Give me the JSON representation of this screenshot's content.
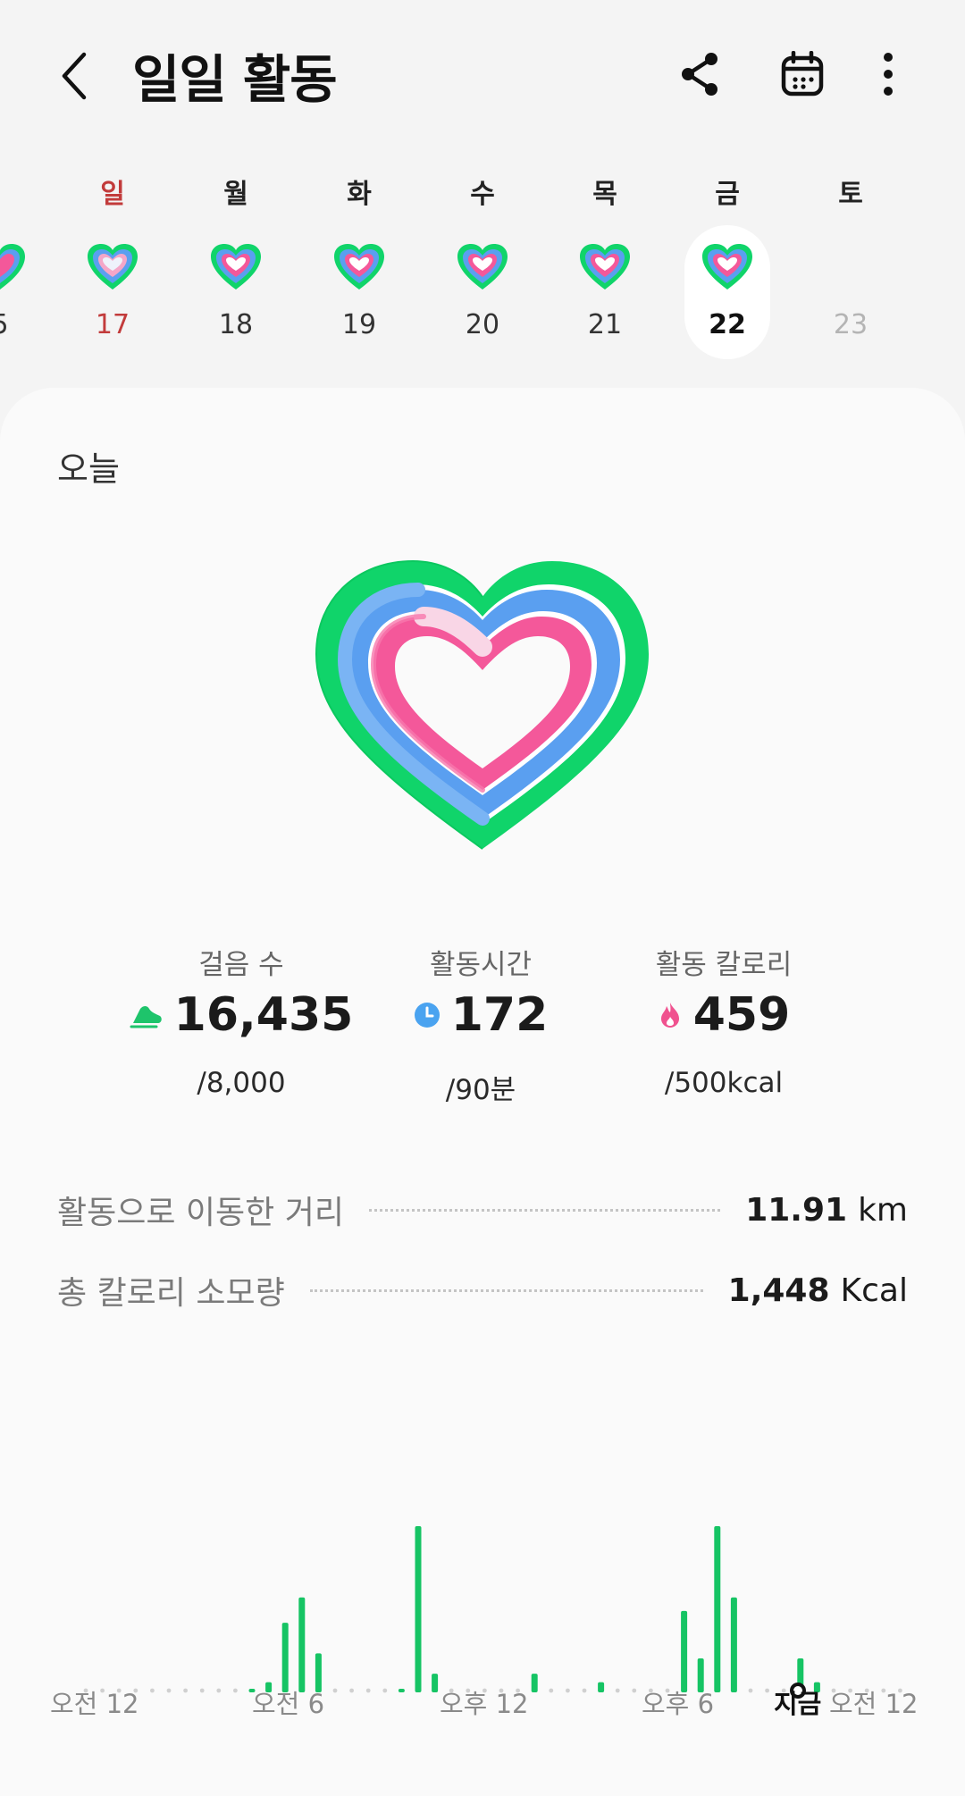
{
  "header": {
    "title": "일일 활동",
    "back_icon": "chevron-left-icon",
    "share_icon": "share-icon",
    "calendar_icon": "calendar-icon",
    "more_icon": "more-vertical-icon"
  },
  "week": {
    "days": [
      {
        "name": "일",
        "date": "17",
        "is_sunday": true
      },
      {
        "name": "월",
        "date": "18"
      },
      {
        "name": "화",
        "date": "19"
      },
      {
        "name": "수",
        "date": "20"
      },
      {
        "name": "목",
        "date": "21"
      },
      {
        "name": "금",
        "date": "22",
        "selected": true
      },
      {
        "name": "토",
        "date": "23",
        "future": true
      }
    ],
    "partial_prev_date": "5"
  },
  "today": {
    "label": "오늘"
  },
  "stats": [
    {
      "label": "걸음 수",
      "value": "16,435",
      "goal": "/8,000",
      "icon": "shoe-icon",
      "color": "#1ec46b"
    },
    {
      "label": "활동시간",
      "value": "172",
      "goal": "/90분",
      "icon": "clock-icon",
      "color": "#4aa3f0"
    },
    {
      "label": "활동 칼로리",
      "value": "459",
      "goal": "/500kcal",
      "icon": "flame-icon",
      "color": "#f0528f"
    }
  ],
  "metrics": [
    {
      "label": "활동으로 이동한 거리",
      "value": "11.91",
      "unit": "km"
    },
    {
      "label": "총 칼로리 소모량",
      "value": "1,448",
      "unit": "Kcal"
    }
  ],
  "colors": {
    "ring_green": "#10d46a",
    "ring_blue": "#5a9ff0",
    "ring_pink": "#f4589a",
    "sunday_red": "#c23b3b",
    "bar_green": "#16c464"
  },
  "chart_data": {
    "type": "bar",
    "x_labels": [
      "오전 12",
      "오전 6",
      "오후 12",
      "오후 6",
      "지금",
      "오전 12"
    ],
    "values": [
      0,
      0,
      0,
      0,
      0,
      0,
      0,
      0,
      0,
      0,
      1,
      6,
      41,
      56,
      23,
      0,
      0,
      0,
      0,
      1,
      98,
      11,
      0,
      0,
      0,
      0,
      0,
      11,
      0,
      0,
      0,
      6,
      0,
      0,
      0,
      0,
      48,
      20,
      98,
      56,
      0,
      0,
      0,
      20,
      6,
      0,
      0,
      0,
      0,
      0
    ]
  }
}
